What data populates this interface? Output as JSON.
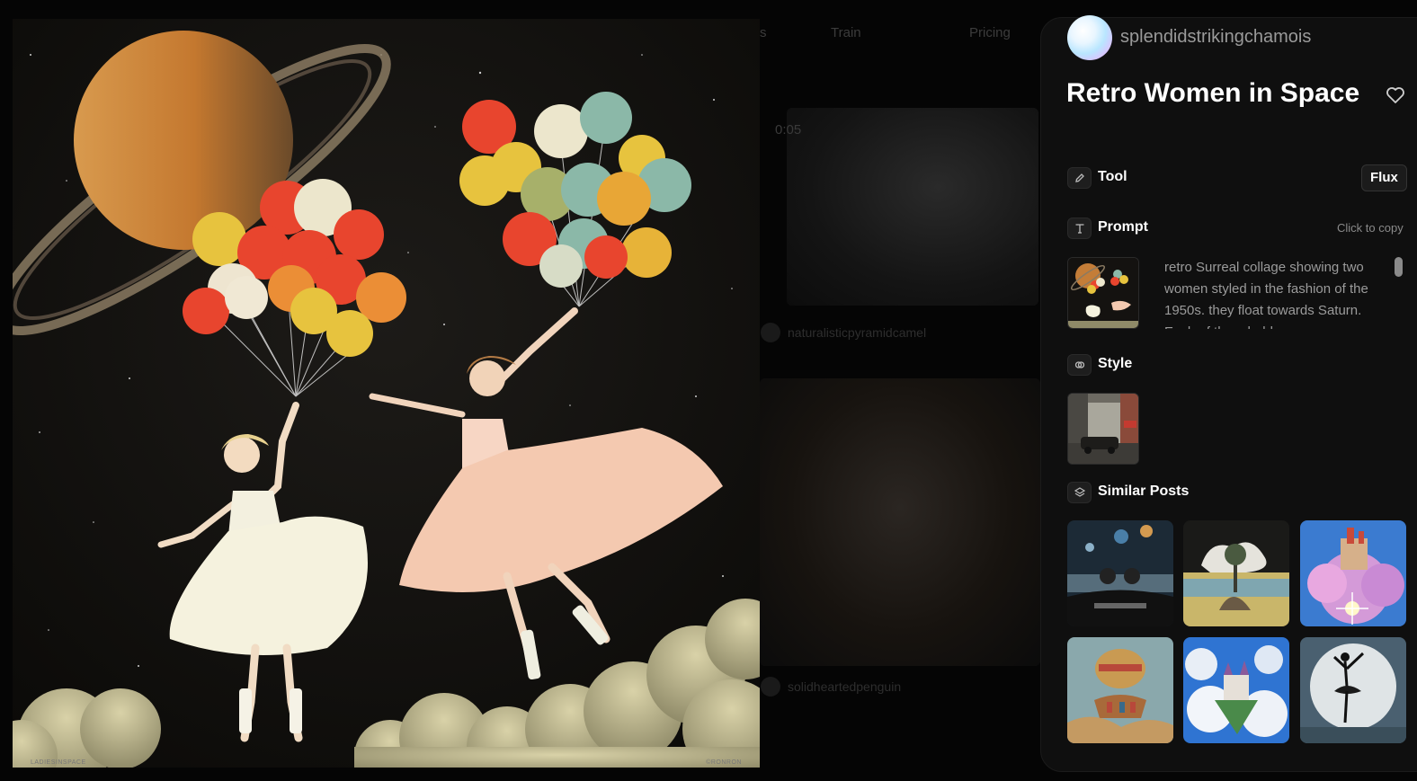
{
  "background_page": {
    "nav": [
      "s",
      "Train",
      "Pricing"
    ],
    "video_time": "0:05",
    "author_1": "naturalisticpyramidcamel",
    "author_2": "solidheartedpenguin"
  },
  "main_image": {
    "watermark_left": "LADIESINSPACE",
    "watermark_right": "©RONRON"
  },
  "post": {
    "username": "splendidstrikingchamois",
    "title": "Retro Women in Space",
    "like_icon": "heart-icon"
  },
  "tool": {
    "label": "Tool",
    "icon": "pencil-icon",
    "value": "Flux"
  },
  "prompt": {
    "label": "Prompt",
    "icon": "text-t-icon",
    "copy_label": "Click to copy",
    "text": "retro Surreal collage showing two women styled in the fashion of the 1950s. they float towards Saturn. Each of them holds"
  },
  "style": {
    "label": "Style",
    "icon": "link-rings-icon"
  },
  "similar_posts": {
    "label": "Similar Posts",
    "icon": "stack-icon",
    "items": [
      {
        "name": "similar-post-couple-in-car"
      },
      {
        "name": "similar-post-island-tree"
      },
      {
        "name": "similar-post-floating-castle"
      },
      {
        "name": "similar-post-hot-air-ship"
      },
      {
        "name": "similar-post-cloud-castle"
      },
      {
        "name": "similar-post-ballerina-moon"
      }
    ]
  },
  "colors": {
    "panel_bg": "#0f0f0f",
    "accent_text": "#ffffff",
    "muted_text": "#9a9a9a"
  }
}
